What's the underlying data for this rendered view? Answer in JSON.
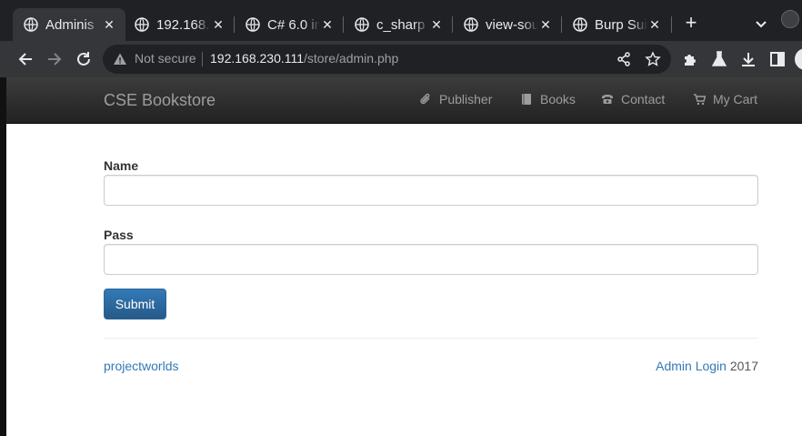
{
  "browser": {
    "tabs": [
      {
        "title": "Adminis",
        "active": true
      },
      {
        "title": "192.168.",
        "active": false
      },
      {
        "title": "C# 6.0 in",
        "active": false
      },
      {
        "title": "c_sharp",
        "active": false
      },
      {
        "title": "view-sou",
        "active": false
      },
      {
        "title": "Burp Sui",
        "active": false
      }
    ],
    "security_label": "Not secure",
    "url_host": "192.168.230.111",
    "url_path": "/store/admin.php"
  },
  "site": {
    "brand": "CSE Bookstore",
    "nav": [
      {
        "label": "Publisher",
        "icon": "paperclip-icon"
      },
      {
        "label": "Books",
        "icon": "book-icon"
      },
      {
        "label": "Contact",
        "icon": "phone-icon"
      },
      {
        "label": "My Cart",
        "icon": "cart-icon"
      }
    ]
  },
  "form": {
    "name_label": "Name",
    "name_value": "",
    "pass_label": "Pass",
    "pass_value": "",
    "submit_label": "Submit"
  },
  "footer": {
    "left_link": "projectworlds",
    "admin_link": "Admin Login",
    "year": "2017"
  },
  "colors": {
    "navbar": "#222222",
    "primary": "#337ab7",
    "chrome_bg": "#202124",
    "chrome_toolbar": "#35363a"
  }
}
